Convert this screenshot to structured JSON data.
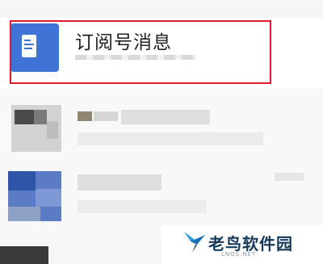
{
  "subscription_row": {
    "title": "订阅号消息",
    "icon": "document-icon",
    "icon_color": "#3f74d6",
    "highlight_color": "#e0192c"
  },
  "watermark": {
    "site_name": "老鸟软件园",
    "url": "LNQS.NET",
    "logo": "bird-logo"
  }
}
